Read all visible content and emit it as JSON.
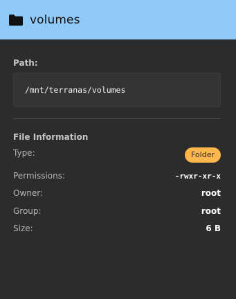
{
  "header": {
    "title": "volumes",
    "icon": "folder-icon"
  },
  "path": {
    "label": "Path:",
    "value": "/mnt/terranas/volumes"
  },
  "file_info": {
    "heading": "File Information",
    "type_label": "Type:",
    "type_value": "Folder",
    "permissions_label": "Permissions:",
    "permissions_value": "-rwxr-xr-x",
    "owner_label": "Owner:",
    "owner_value": "root",
    "group_label": "Group:",
    "group_value": "root",
    "size_label": "Size:",
    "size_value": "6 B"
  },
  "colors": {
    "header_bg": "#90caf9",
    "panel_bg": "#2c2c2c",
    "badge_bg": "#ffb74d"
  }
}
